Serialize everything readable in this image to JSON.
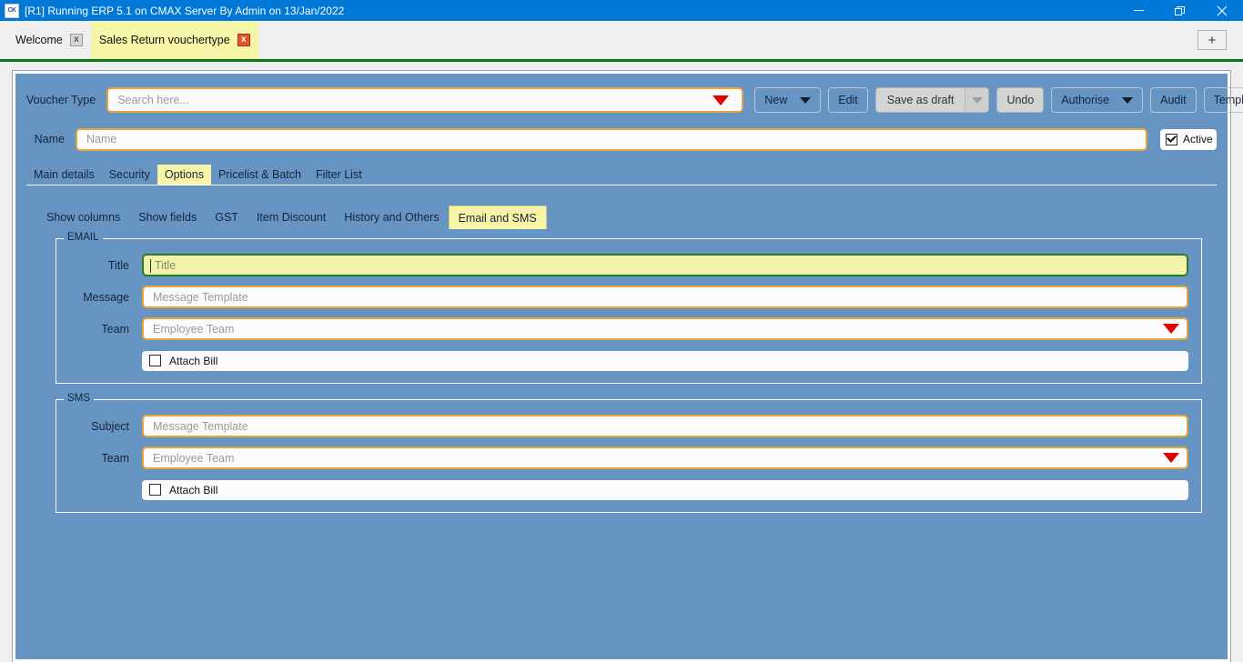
{
  "window": {
    "title": "[R1] Running ERP 5.1 on CMAX Server By Admin on 13/Jan/2022",
    "app_icon": "CK",
    "minimize_label": "minimize-icon",
    "restore_label": "restore-icon",
    "close_label": "close-icon"
  },
  "tabstrip": {
    "tabs": [
      {
        "label": "Welcome",
        "close": "x",
        "active": false
      },
      {
        "label": "Sales Return vouchertype",
        "close": "x",
        "active": true
      }
    ],
    "add_label": "+"
  },
  "form": {
    "voucher_type_label": "Voucher Type",
    "voucher_type_placeholder": "Search here...",
    "name_label": "Name",
    "name_placeholder": "Name",
    "active_label": "Active",
    "active_checked": true
  },
  "toolbar": {
    "new_label": "New",
    "edit_label": "Edit",
    "save_as_draft_label": "Save as draft",
    "undo_label": "Undo",
    "authorise_label": "Authorise",
    "audit_label": "Audit",
    "template_label": "Template"
  },
  "main_tabs": [
    {
      "label": "Main details",
      "active": false
    },
    {
      "label": "Security",
      "active": false
    },
    {
      "label": "Options",
      "active": true
    },
    {
      "label": "Pricelist & Batch",
      "active": false
    },
    {
      "label": "Filter List",
      "active": false
    }
  ],
  "sub_tabs": [
    {
      "label": "Show columns",
      "active": false
    },
    {
      "label": "Show fields",
      "active": false
    },
    {
      "label": "GST",
      "active": false
    },
    {
      "label": "Item Discount",
      "active": false
    },
    {
      "label": "History and Others",
      "active": false
    },
    {
      "label": "Email and SMS",
      "active": true
    }
  ],
  "email": {
    "legend": "EMAIL",
    "title_label": "Title",
    "title_placeholder": "Title",
    "message_label": "Message",
    "message_placeholder": "Message Template",
    "team_label": "Team",
    "team_placeholder": "Employee Team",
    "attach_bill_label": "Attach Bill",
    "attach_bill_checked": false
  },
  "sms": {
    "legend": "SMS",
    "subject_label": "Subject",
    "subject_placeholder": "Message Template",
    "team_label": "Team",
    "team_placeholder": "Employee Team",
    "attach_bill_label": "Attach Bill",
    "attach_bill_checked": false
  },
  "colors": {
    "titlebar": "#0078d7",
    "panel": "#6695c4",
    "active_tab": "#f7f6a8",
    "field_border": "#e8a33d",
    "focus_border": "#2a7a2a",
    "dropdown_arrow": "#e00000",
    "accent_line": "#0a7a1e"
  }
}
